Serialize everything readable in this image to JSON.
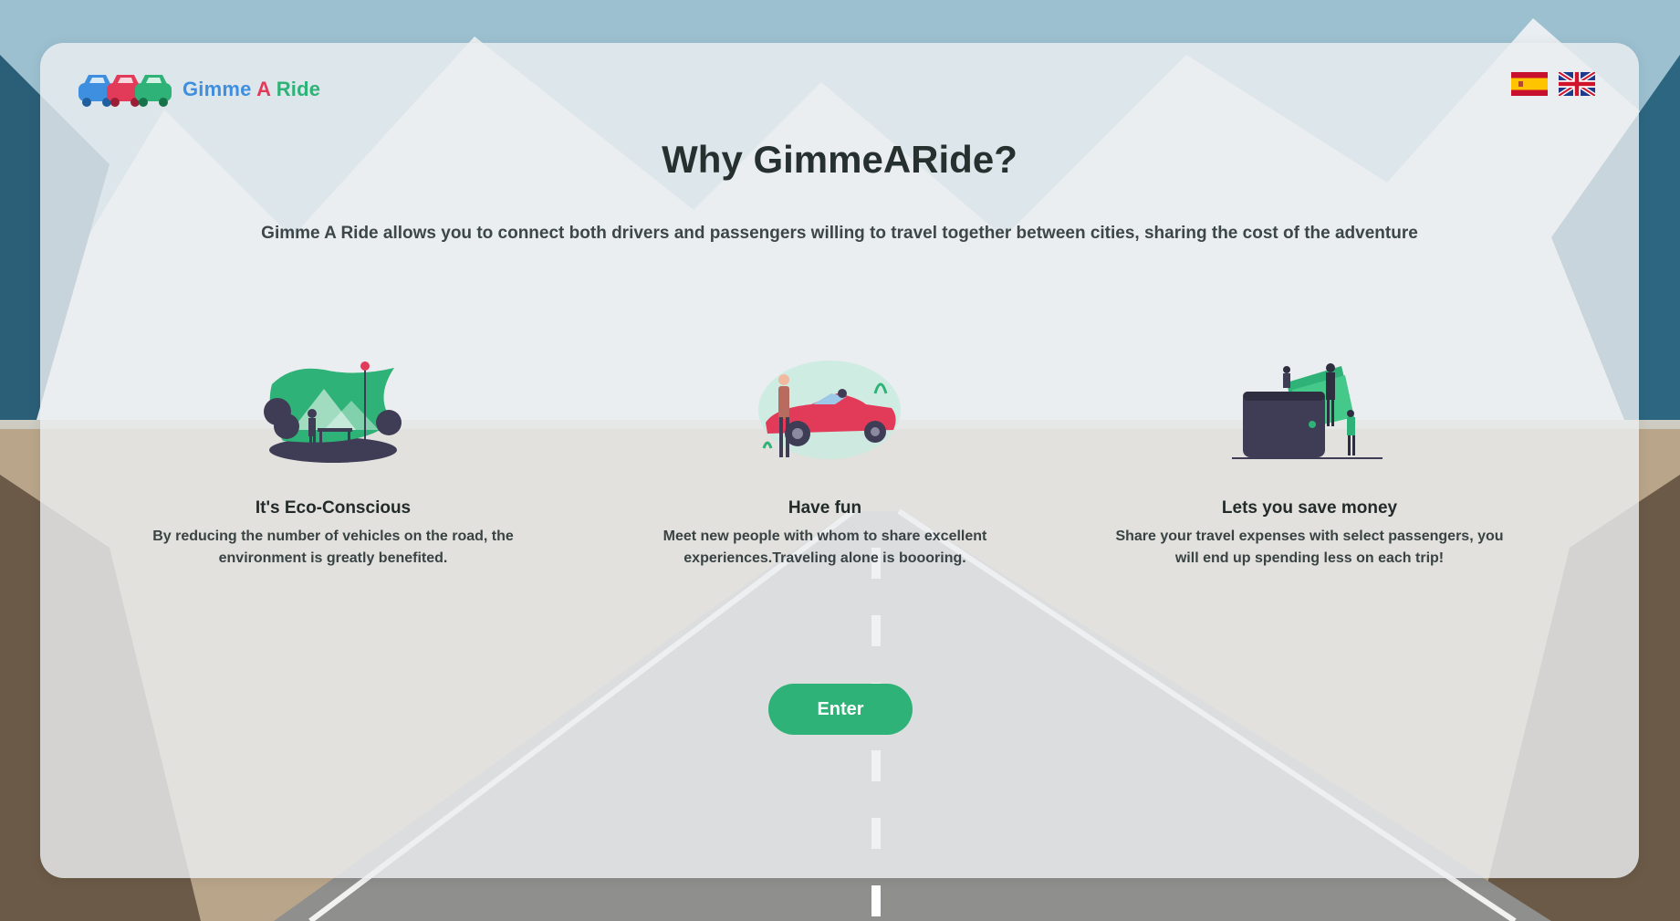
{
  "app": {
    "logo_parts": {
      "first": "Gimme",
      "second": "A",
      "third": "Ride"
    },
    "brand_colors": {
      "blue": "#3f8fe0",
      "red": "#e23b5a",
      "green": "#2fb277"
    }
  },
  "languages": [
    {
      "code": "es",
      "icon": "spanish-flag-icon"
    },
    {
      "code": "en",
      "icon": "uk-flag-icon"
    }
  ],
  "hero": {
    "title": "Why GimmeARide?",
    "subtitle": "Gimme A Ride allows you to connect both drivers and passengers willing to travel together between cities, sharing the cost of the adventure"
  },
  "features": [
    {
      "icon": "eco-park-illustration",
      "title": "It's Eco-Conscious",
      "text": "By reducing the number of vehicles on the road, the environment is greatly benefited."
    },
    {
      "icon": "convertible-car-illustration",
      "title": "Have fun",
      "text": "Meet new people with whom to share excellent experiences.Traveling alone is boooring."
    },
    {
      "icon": "wallet-money-illustration",
      "title": "Lets you save money",
      "text": "Share your travel expenses with select passengers, you will end up spending less on each trip!"
    }
  ],
  "cta": {
    "enter_label": "Enter",
    "color": "#2fb277"
  }
}
